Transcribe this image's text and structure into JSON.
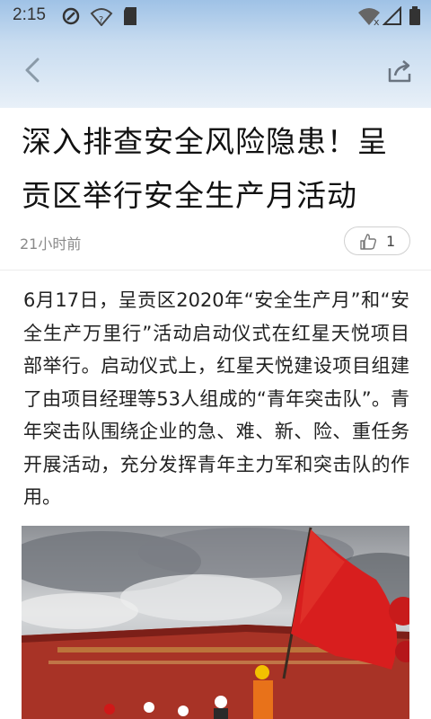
{
  "status_bar": {
    "time": "2:15"
  },
  "article": {
    "title": "深入排查安全风险隐患！呈贡区举行安全生产月活动",
    "time_ago": "21小时前",
    "likes": "1",
    "paragraph": "6月17日，呈贡区2020年“安全生产月”和“安全生产万里行”活动启动仪式在红星天悦项目部举行。启动仪式上，红星天悦建设项目组建了由项目经理等53人组成的“青年突击队”。青年突击队围绕企业的急、难、新、险、重任务开展活动，充分发挥青年主力军和突击队的作用。"
  },
  "icons": {
    "back": "back-arrow-icon",
    "share": "share-icon",
    "like": "thumbs-up-icon"
  },
  "colors": {
    "header_top": "#9fc2e6",
    "flag_red": "#d81e1e",
    "banner_red": "#b22a22"
  }
}
